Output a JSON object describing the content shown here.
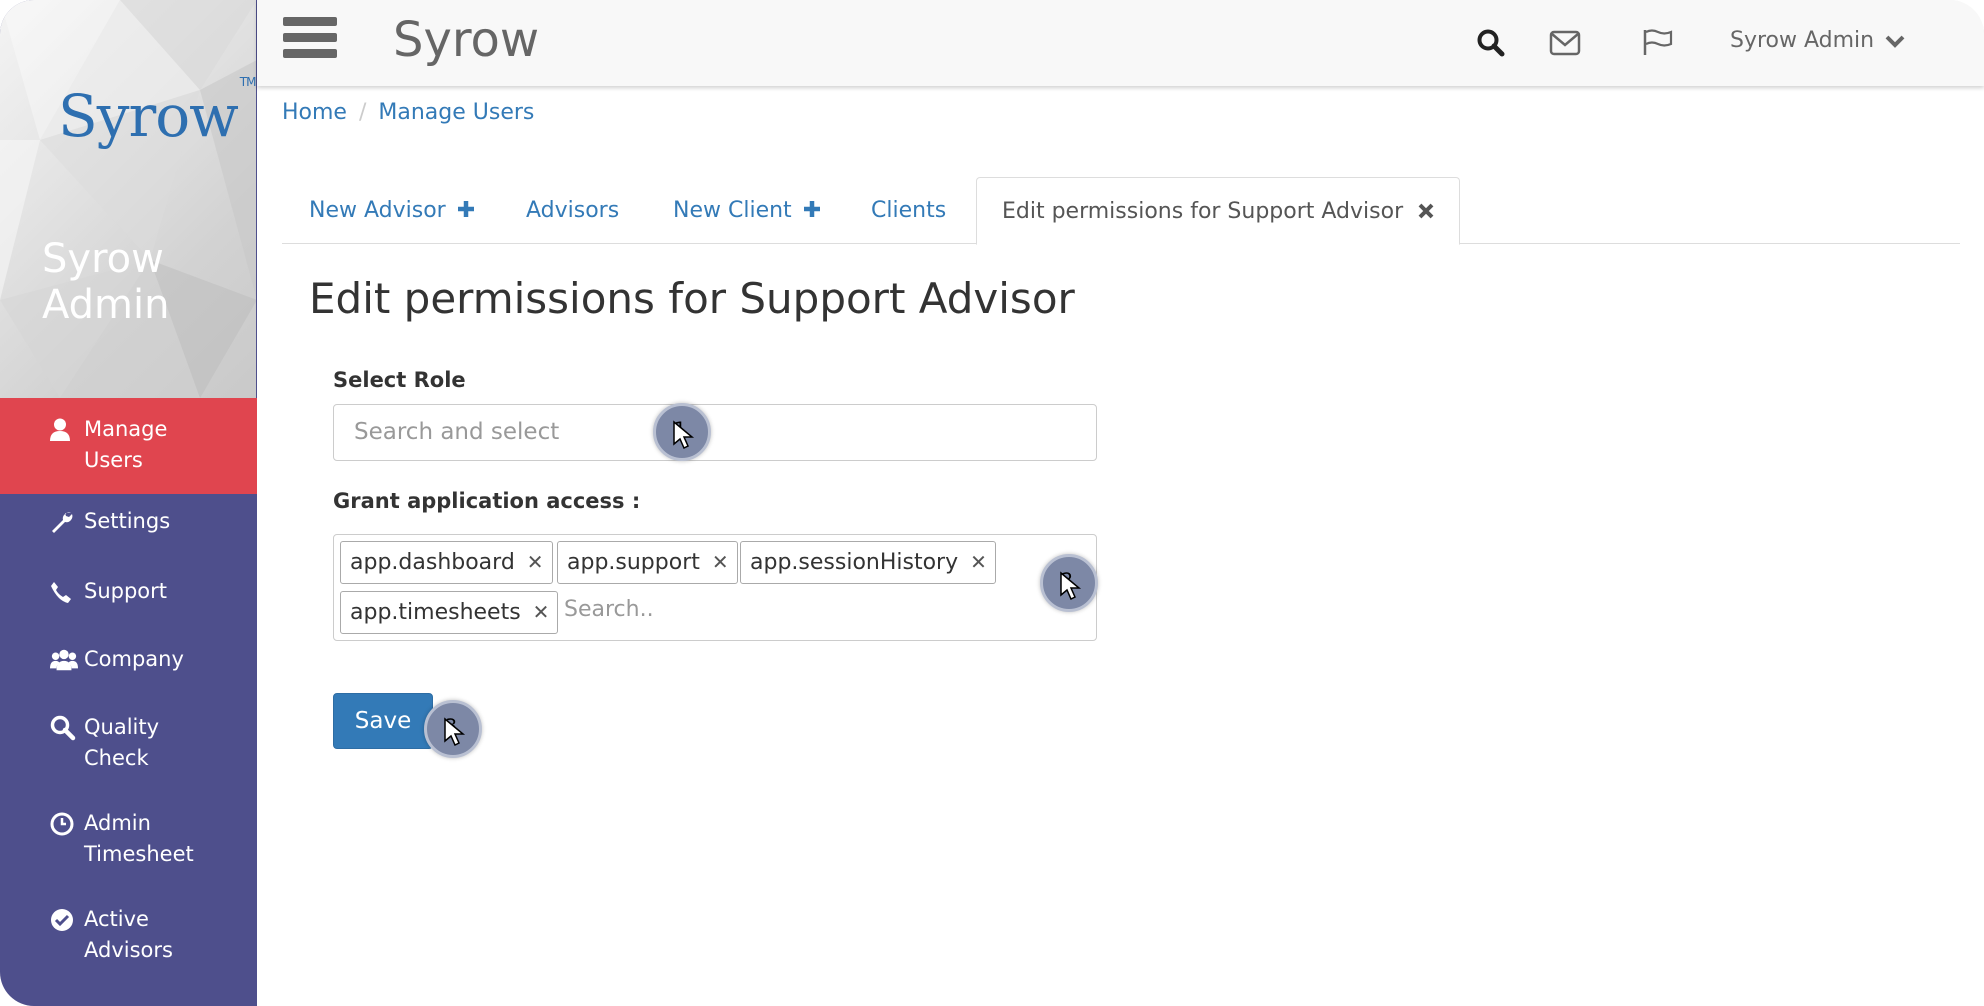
{
  "sidebar": {
    "logo": "Syrow",
    "logo_tm": "TM",
    "user_name": "Syrow Admin",
    "items": [
      {
        "label": "Manage\nUsers",
        "icon": "user-icon",
        "active": true
      },
      {
        "label": "Settings",
        "icon": "wrench-icon"
      },
      {
        "label": "Support",
        "icon": "phone-icon"
      },
      {
        "label": "Company",
        "icon": "users-icon"
      },
      {
        "label": "Quality\nCheck",
        "icon": "search-icon"
      },
      {
        "label": "Admin\nTimesheet",
        "icon": "clock-icon"
      },
      {
        "label": "Active\nAdvisors",
        "icon": "check-circle-icon"
      }
    ]
  },
  "topbar": {
    "brand": "Syrow",
    "user_menu": "Syrow Admin",
    "icons": [
      "menu-icon",
      "search-icon",
      "envelope-icon",
      "flag-icon",
      "chevron-down-icon"
    ]
  },
  "breadcrumb": {
    "home": "Home",
    "current": "Manage Users"
  },
  "tabs": [
    {
      "label": "New Advisor",
      "icon": "plus-icon"
    },
    {
      "label": "Advisors"
    },
    {
      "label": "New Client",
      "icon": "plus-icon"
    },
    {
      "label": "Clients"
    },
    {
      "label": "Edit permissions for Support Advisor",
      "icon": "close-icon",
      "active": true
    }
  ],
  "page_title": "Edit permissions for Support Advisor",
  "form": {
    "role_label": "Select Role",
    "role_placeholder": "Search and select",
    "access_label": "Grant application access :",
    "access_tags": [
      "app.dashboard",
      "app.support",
      "app.sessionHistory",
      "app.timesheets"
    ],
    "access_search_placeholder": "Search..",
    "save_label": "Save"
  },
  "markers": [
    "1",
    "2",
    "3"
  ],
  "colors": {
    "sidebar_bg": "#4e4f8c",
    "active_item": "#e0454f",
    "link": "#337ab7",
    "primary_button": "#337ab7",
    "marker": "#7d88a6"
  }
}
